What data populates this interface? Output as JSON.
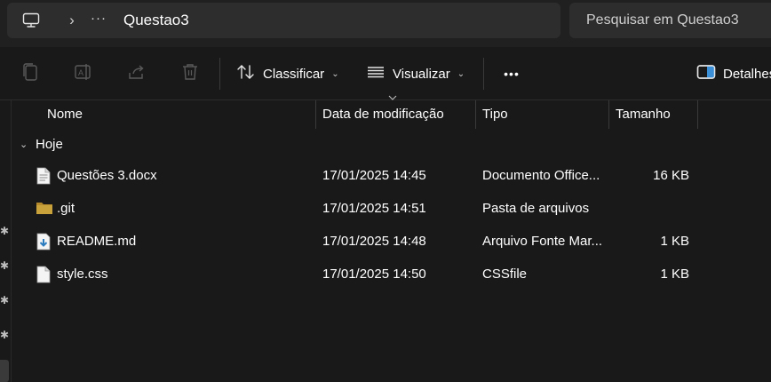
{
  "address": {
    "location_icon": "this-pc-icon",
    "separator_icon": "chevron-right-icon",
    "more_label": "···",
    "current_folder": "Questao3"
  },
  "search": {
    "placeholder": "Pesquisar em Questao3"
  },
  "toolbar": {
    "copy_icon": "copy-icon",
    "rename_icon": "rename-icon",
    "share_icon": "share-icon",
    "delete_icon": "trash-icon",
    "sort_label": "Classificar",
    "view_label": "Visualizar",
    "more_label": "•••",
    "details_label": "Detalhes"
  },
  "columns": {
    "name": "Nome",
    "date": "Data de modificação",
    "type": "Tipo",
    "size": "Tamanho"
  },
  "group": {
    "label": "Hoje"
  },
  "files": [
    {
      "name": "Questões 3.docx",
      "date": "17/01/2025 14:45",
      "type": "Documento Office...",
      "size": "16 KB",
      "icon": "document-icon"
    },
    {
      "name": ".git",
      "date": "17/01/2025 14:51",
      "type": "Pasta de arquivos",
      "size": "",
      "icon": "folder-icon"
    },
    {
      "name": "README.md",
      "date": "17/01/2025 14:48",
      "type": "Arquivo Fonte Mar...",
      "size": "1 KB",
      "icon": "markdown-file-icon"
    },
    {
      "name": "style.css",
      "date": "17/01/2025 14:50",
      "type": "CSSfile",
      "size": "1 KB",
      "icon": "file-icon"
    }
  ],
  "colors": {
    "background": "#191919",
    "chrome": "#202020",
    "field": "#2d2d2d",
    "folder": "#c9a23c"
  }
}
